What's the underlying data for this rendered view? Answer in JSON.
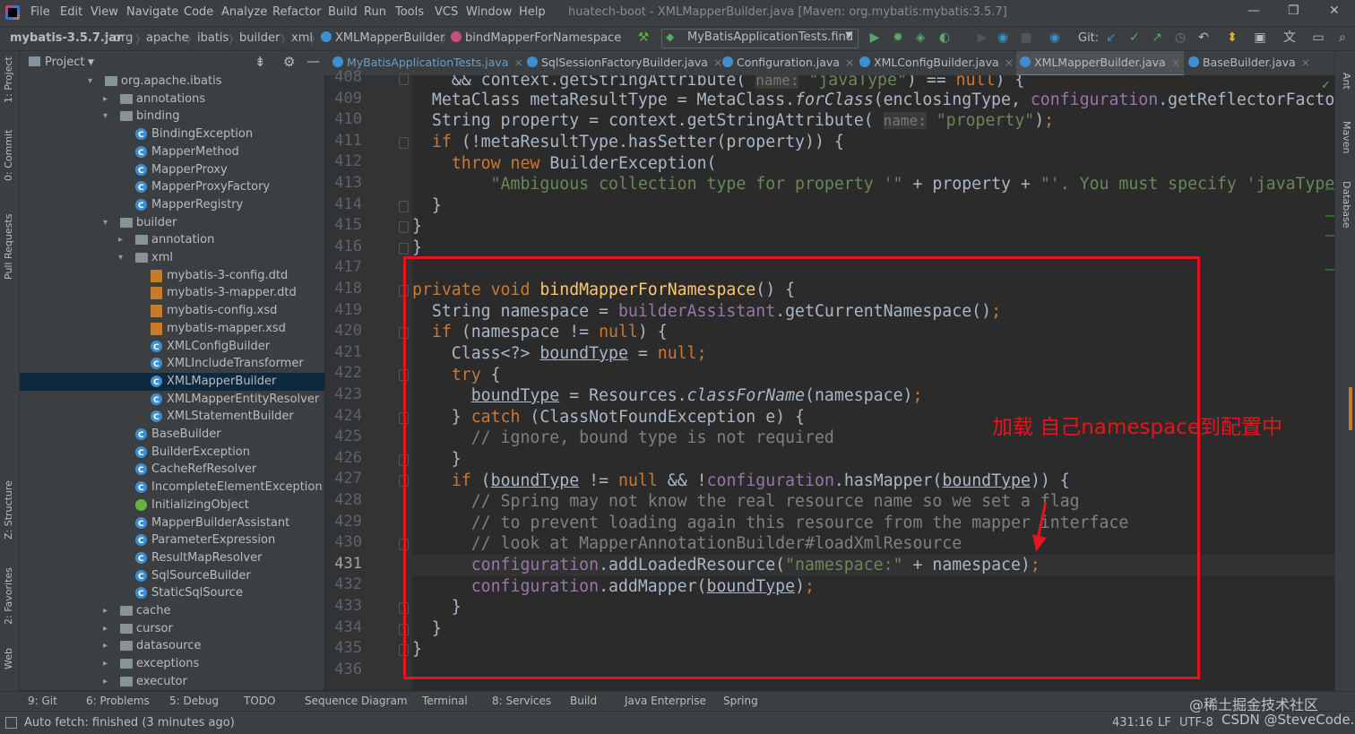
{
  "menu": [
    "File",
    "Edit",
    "View",
    "Navigate",
    "Code",
    "Analyze",
    "Refactor",
    "Build",
    "Run",
    "Tools",
    "VCS",
    "Window",
    "Help"
  ],
  "window_title": "huatech-boot - XMLMapperBuilder.java [Maven: org.mybatis:mybatis:3.5.7]",
  "breadcrumbs": [
    "mybatis-3.5.7.jar",
    "org",
    "apache",
    "ibatis",
    "builder",
    "xml",
    "XMLMapperBuilder",
    "bindMapperForNamespace"
  ],
  "run_config": "MyBatisApplicationTests.find",
  "git_label": "Git:",
  "project_label": "Project",
  "editor_tabs": [
    "MyBatisApplicationTests.java",
    "SqlSessionFactoryBuilder.java",
    "Configuration.java",
    "XMLConfigBuilder.java",
    "XMLMapperBuilder.java",
    "BaseBuilder.java"
  ],
  "tree": [
    {
      "label": "org.apache.ibatis",
      "kind": "folder",
      "open": true
    },
    {
      "label": "annotations",
      "kind": "folder",
      "open": false
    },
    {
      "label": "binding",
      "kind": "folder",
      "open": true
    },
    {
      "label": "BindingException",
      "kind": "class"
    },
    {
      "label": "MapperMethod",
      "kind": "class"
    },
    {
      "label": "MapperProxy",
      "kind": "class"
    },
    {
      "label": "MapperProxyFactory",
      "kind": "class"
    },
    {
      "label": "MapperRegistry",
      "kind": "class"
    },
    {
      "label": "builder",
      "kind": "folder",
      "open": true
    },
    {
      "label": "annotation",
      "kind": "folder",
      "open": false
    },
    {
      "label": "xml",
      "kind": "folder",
      "open": true
    },
    {
      "label": "mybatis-3-config.dtd",
      "kind": "dtd"
    },
    {
      "label": "mybatis-3-mapper.dtd",
      "kind": "dtd"
    },
    {
      "label": "mybatis-config.xsd",
      "kind": "dtd"
    },
    {
      "label": "mybatis-mapper.xsd",
      "kind": "dtd"
    },
    {
      "label": "XMLConfigBuilder",
      "kind": "class"
    },
    {
      "label": "XMLIncludeTransformer",
      "kind": "class"
    },
    {
      "label": "XMLMapperBuilder",
      "kind": "class",
      "selected": true
    },
    {
      "label": "XMLMapperEntityResolver",
      "kind": "class"
    },
    {
      "label": "XMLStatementBuilder",
      "kind": "class"
    },
    {
      "label": "BaseBuilder",
      "kind": "class"
    },
    {
      "label": "BuilderException",
      "kind": "class"
    },
    {
      "label": "CacheRefResolver",
      "kind": "class"
    },
    {
      "label": "IncompleteElementException",
      "kind": "class"
    },
    {
      "label": "InitializingObject",
      "kind": "interface"
    },
    {
      "label": "MapperBuilderAssistant",
      "kind": "class"
    },
    {
      "label": "ParameterExpression",
      "kind": "class"
    },
    {
      "label": "ResultMapResolver",
      "kind": "class"
    },
    {
      "label": "SqlSourceBuilder",
      "kind": "class"
    },
    {
      "label": "StaticSqlSource",
      "kind": "class"
    },
    {
      "label": "cache",
      "kind": "folder",
      "open": false
    },
    {
      "label": "cursor",
      "kind": "folder",
      "open": false
    },
    {
      "label": "datasource",
      "kind": "folder",
      "open": false
    },
    {
      "label": "exceptions",
      "kind": "folder",
      "open": false
    },
    {
      "label": "executor",
      "kind": "folder",
      "open": false
    }
  ],
  "line_numbers": [
    "408",
    "409",
    "410",
    "411",
    "412",
    "413",
    "414",
    "415",
    "416",
    "417",
    "418",
    "419",
    "420",
    "421",
    "422",
    "423",
    "424",
    "425",
    "426",
    "427",
    "428",
    "429",
    "430",
    "431",
    "432",
    "433",
    "434",
    "435",
    "436"
  ],
  "current_line": "431",
  "annotation_text": "加载 自己namespace到配置中",
  "left_tabs": [
    "1: Project",
    "0: Commit",
    "Pull Requests",
    "Z: Structure",
    "2: Favorites",
    "Web"
  ],
  "right_tabs": [
    "Ant",
    "Maven",
    "Database"
  ],
  "bottom_tabs": [
    "9: Git",
    "6: Problems",
    "5: Debug",
    "TODO",
    "Sequence Diagram",
    "Terminal",
    "8: Services",
    "Build",
    "Java Enterprise",
    "Spring"
  ],
  "status_text": "Auto fetch: finished (3 minutes ago)",
  "cursor_pos": "431:16",
  "line_sep": "LF",
  "encoding": "UTF-8",
  "watermark1": "@稀土掘金技术社区",
  "watermark2": "CSDN @SteveCode."
}
